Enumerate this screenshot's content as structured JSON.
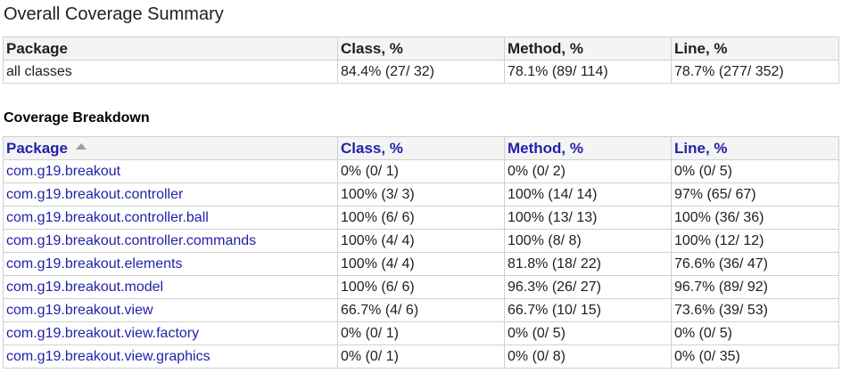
{
  "page": {
    "title": "Overall Coverage Summary"
  },
  "summary": {
    "headers": [
      "Package",
      "Class, %",
      "Method, %",
      "Line, %"
    ],
    "rows": [
      [
        "all classes",
        "84.4% (27/ 32)",
        "78.1% (89/ 114)",
        "78.7% (277/ 352)"
      ]
    ]
  },
  "breakdown": {
    "title": "Coverage Breakdown",
    "headers": [
      "Package",
      "Class, %",
      "Method, %",
      "Line, %"
    ],
    "sort_icon": "sort-ascending-icon",
    "rows": [
      [
        "com.g19.breakout",
        "0% (0/ 1)",
        "0% (0/ 2)",
        "0% (0/ 5)"
      ],
      [
        "com.g19.breakout.controller",
        "100% (3/ 3)",
        "100% (14/ 14)",
        "97% (65/ 67)"
      ],
      [
        "com.g19.breakout.controller.ball",
        "100% (6/ 6)",
        "100% (13/ 13)",
        "100% (36/ 36)"
      ],
      [
        "com.g19.breakout.controller.commands",
        "100% (4/ 4)",
        "100% (8/ 8)",
        "100% (12/ 12)"
      ],
      [
        "com.g19.breakout.elements",
        "100% (4/ 4)",
        "81.8% (18/ 22)",
        "76.6% (36/ 47)"
      ],
      [
        "com.g19.breakout.model",
        "100% (6/ 6)",
        "96.3% (26/ 27)",
        "96.7% (89/ 92)"
      ],
      [
        "com.g19.breakout.view",
        "66.7% (4/ 6)",
        "66.7% (10/ 15)",
        "73.6% (39/ 53)"
      ],
      [
        "com.g19.breakout.view.factory",
        "0% (0/ 1)",
        "0% (0/ 5)",
        "0% (0/ 5)"
      ],
      [
        "com.g19.breakout.view.graphics",
        "0% (0/ 1)",
        "0% (0/ 8)",
        "0% (0/ 35)"
      ]
    ]
  },
  "colors": {
    "link": "#2222aa",
    "header_bg": "#f4f4f4",
    "border": "#d0d0d0"
  }
}
